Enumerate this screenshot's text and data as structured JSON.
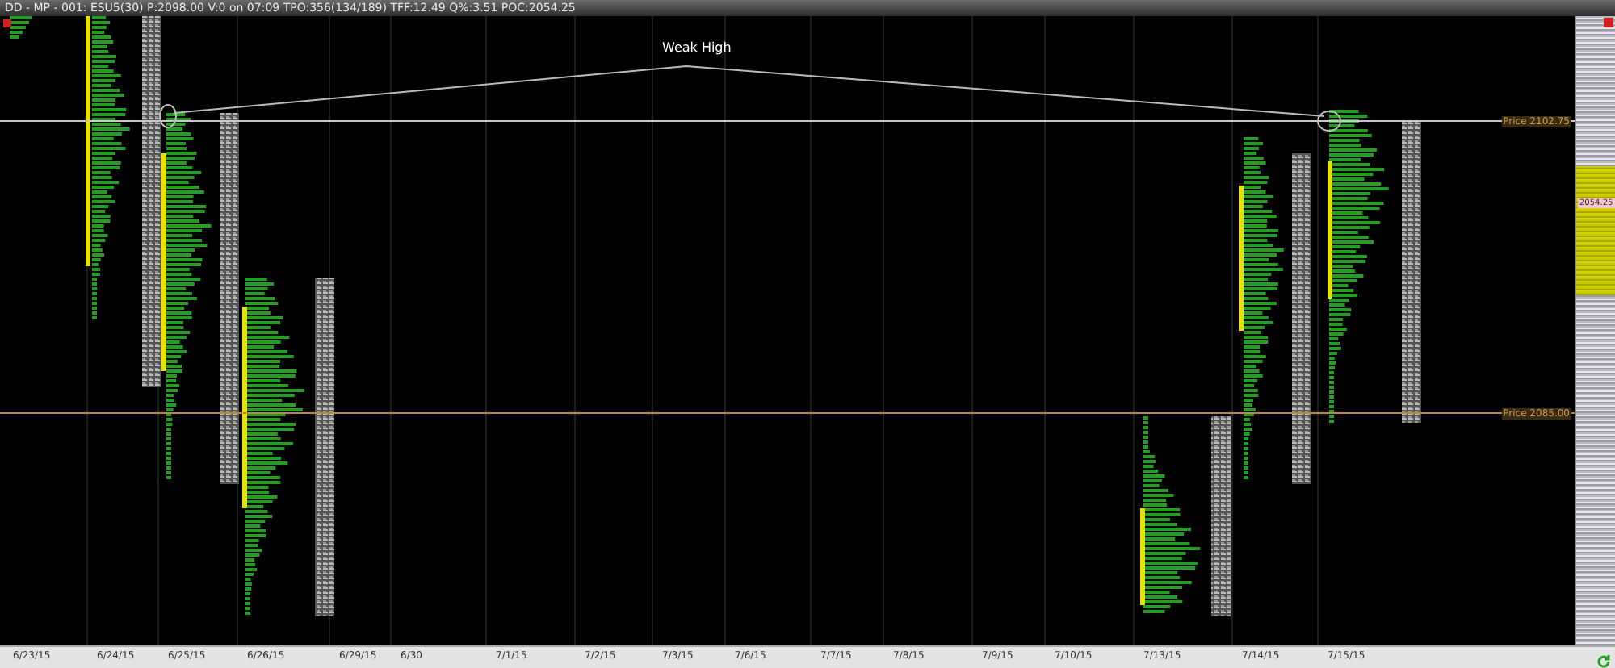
{
  "window": {
    "title": "DD - MP - 001: ESU5(30) P:2098.00 V:0 on 07:09 TPO:356(134/189) TFF:12.49 Q%:3.51 POC:2054.25"
  },
  "chart": {
    "annotation": "Weak High",
    "lines": [
      {
        "kind": "high",
        "label": "Price 2102.75"
      },
      {
        "kind": "level",
        "label": "Price 2085.00"
      }
    ]
  },
  "price_axis": {
    "poc_label": "2054.25"
  },
  "date_axis": [
    "6/23/15",
    "6/24/15",
    "6/25/15",
    "6/26/15",
    "6/29/15",
    "6/30",
    "7/1/15",
    "7/2/15",
    "7/3/15",
    "7/6/15",
    "7/7/15",
    "7/8/15",
    "7/9/15",
    "7/10/15",
    "7/13/15",
    "7/14/15",
    "7/15/15"
  ]
}
